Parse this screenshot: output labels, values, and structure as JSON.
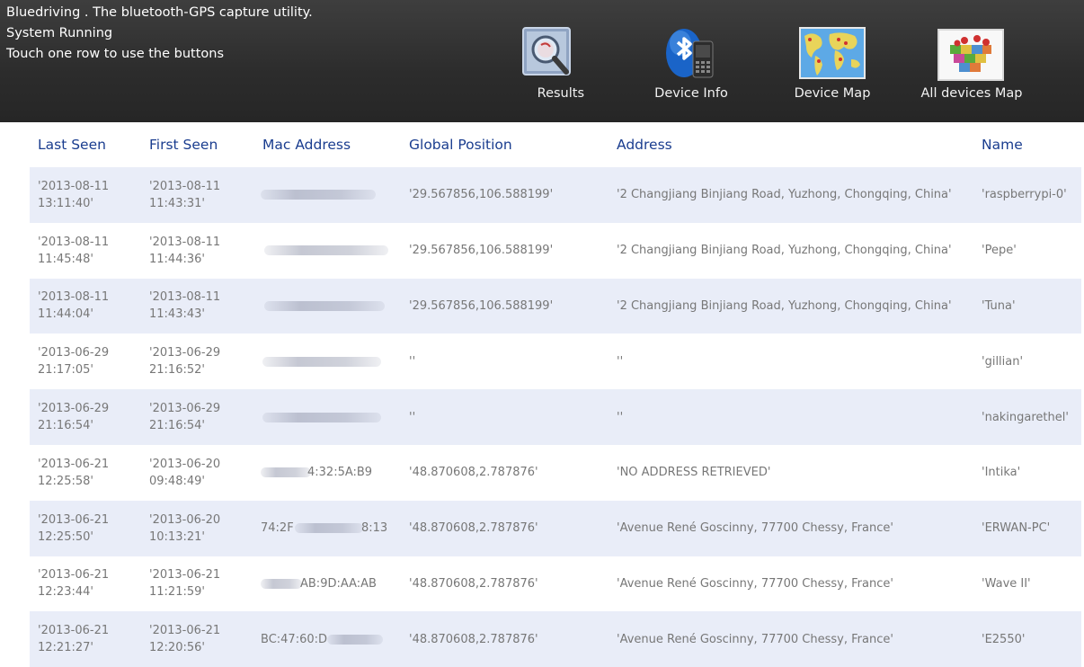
{
  "header": {
    "line1": "Bluedriving . The bluetooth-GPS capture utility.",
    "line2": "System Running",
    "line3": "Touch one row to use the buttons"
  },
  "toolbar": {
    "results": {
      "label": "Results",
      "icon": "magnifier-icon"
    },
    "device_info": {
      "label": "Device Info",
      "icon": "bluetooth-phone-icon"
    },
    "device_map": {
      "label": "Device Map",
      "icon": "world-map-icon"
    },
    "all_devices_map": {
      "label": "All devices Map",
      "icon": "map-pins-icon"
    }
  },
  "table": {
    "columns": [
      "Last Seen",
      "First Seen",
      "Mac Address",
      "Global Position",
      "Address",
      "Name"
    ],
    "rows": [
      {
        "last_seen": "'2013-08-11 13:11:40'",
        "first_seen": "'2013-08-11 11:43:31'",
        "mac": "",
        "gps": "'29.567856,106.588199'",
        "address": "'2 Changjiang Binjiang Road, Yuzhong, Chongqing, China'",
        "name": "'raspberrypi-0'"
      },
      {
        "last_seen": "'2013-08-11 11:45:48'",
        "first_seen": "'2013-08-11 11:44:36'",
        "mac": "",
        "gps": "'29.567856,106.588199'",
        "address": "'2 Changjiang Binjiang Road, Yuzhong, Chongqing, China'",
        "name": "'Pepe'"
      },
      {
        "last_seen": "'2013-08-11 11:44:04'",
        "first_seen": "'2013-08-11 11:43:43'",
        "mac": "",
        "gps": "'29.567856,106.588199'",
        "address": "'2 Changjiang Binjiang Road, Yuzhong, Chongqing, China'",
        "name": "'Tuna'"
      },
      {
        "last_seen": "'2013-06-29 21:17:05'",
        "first_seen": "'2013-06-29 21:16:52'",
        "mac": "",
        "gps": "''",
        "address": "''",
        "name": "'gillian'"
      },
      {
        "last_seen": "'2013-06-29 21:16:54'",
        "first_seen": "'2013-06-29 21:16:54'",
        "mac": "",
        "gps": "''",
        "address": "''",
        "name": "'nakingarethel'"
      },
      {
        "last_seen": "'2013-06-21 12:25:58'",
        "first_seen": "'2013-06-20 09:48:49'",
        "mac": "4:32:5A:B9",
        "gps": "'48.870608,2.787876'",
        "address": "'NO ADDRESS RETRIEVED'",
        "name": "'Intika'"
      },
      {
        "last_seen": "'2013-06-21 12:25:50'",
        "first_seen": "'2013-06-20 10:13:21'",
        "mac": "74:2F",
        "mac_tail": "8:13",
        "gps": "'48.870608,2.787876'",
        "address": "'Avenue René Goscinny, 77700 Chessy, France'",
        "name": "'ERWAN-PC'"
      },
      {
        "last_seen": "'2013-06-21 12:23:44'",
        "first_seen": "'2013-06-21 11:21:59'",
        "mac": "AB:9D:AA:AB",
        "gps": "'48.870608,2.787876'",
        "address": "'Avenue René Goscinny, 77700 Chessy, France'",
        "name": "'Wave II'"
      },
      {
        "last_seen": "'2013-06-21 12:21:27'",
        "first_seen": "'2013-06-21 12:20:56'",
        "mac": "BC:47:60:D",
        "gps": "'48.870608,2.787876'",
        "address": "'Avenue René Goscinny, 77700 Chessy, France'",
        "name": "'E2550'"
      }
    ]
  },
  "colors": {
    "header_bg": "#2f2f2f",
    "row_alt": "#e9edf8",
    "column_header": "#1a3d8f",
    "cell_text": "#777777"
  }
}
